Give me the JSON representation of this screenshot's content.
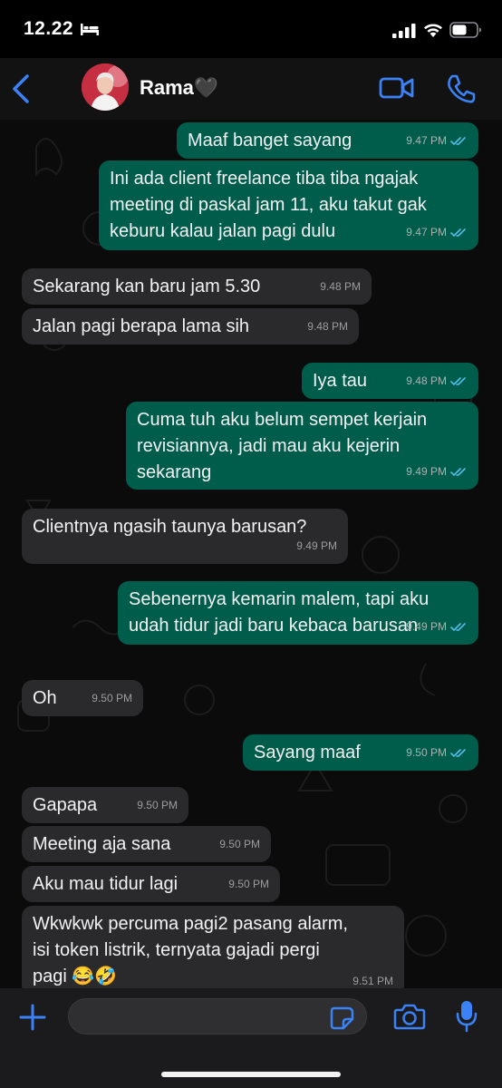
{
  "status_bar": {
    "time": "12.22"
  },
  "header": {
    "contact_name": "Rama🖤"
  },
  "messages": [
    {
      "dir": "out",
      "text": "Maaf banget sayang",
      "time": "9.47 PM"
    },
    {
      "dir": "out",
      "text": "Ini ada client freelance tiba tiba ngajak\nmeeting di paskal jam 11, aku takut gak\nkeburu kalau jalan pagi dulu",
      "time": "9.47 PM"
    },
    {
      "dir": "in",
      "text": "Sekarang kan baru jam 5.30",
      "time": "9.48 PM"
    },
    {
      "dir": "in",
      "text": "Jalan pagi berapa lama sih",
      "time": "9.48 PM"
    },
    {
      "dir": "out",
      "text": "Iya tau",
      "time": "9.48 PM"
    },
    {
      "dir": "out",
      "text": "Cuma tuh aku belum sempet kerjain\nrevisiannya, jadi mau aku kejerin\nsekarang",
      "time": "9.49 PM"
    },
    {
      "dir": "in",
      "text": "Clientnya ngasih taunya barusan?",
      "time": "9.49 PM"
    },
    {
      "dir": "out",
      "text": "Sebenernya kemarin malem, tapi aku\nudah tidur jadi baru kebaca barusan",
      "time": "9.49 PM"
    },
    {
      "dir": "in",
      "text": "Oh",
      "time": "9.50 PM"
    },
    {
      "dir": "out",
      "text": "Sayang maaf",
      "time": "9.50 PM"
    },
    {
      "dir": "in",
      "text": "Gapapa",
      "time": "9.50 PM"
    },
    {
      "dir": "in",
      "text": "Meeting aja sana",
      "time": "9.50 PM"
    },
    {
      "dir": "in",
      "text": "Aku mau tidur lagi",
      "time": "9.50 PM"
    },
    {
      "dir": "in",
      "text": "Wkwkwk percuma pagi2 pasang alarm,\nisi token listrik, ternyata gajadi pergi\npagi 😂🤣",
      "time": "9.51 PM"
    }
  ],
  "input": {
    "value": "",
    "placeholder": ""
  },
  "colors": {
    "accent": "#3b82f6",
    "outgoing_bubble": "#005c4b",
    "incoming_bubble": "#2a2a2c",
    "read_ticks": "#53bdeb"
  },
  "icons": {
    "status": [
      "bed-icon",
      "signal-icon",
      "wifi-icon",
      "battery-icon"
    ],
    "header": [
      "back-icon",
      "video-call-icon",
      "voice-call-icon"
    ],
    "input_bar": [
      "plus-icon",
      "sticker-icon",
      "camera-icon",
      "microphone-icon"
    ]
  }
}
